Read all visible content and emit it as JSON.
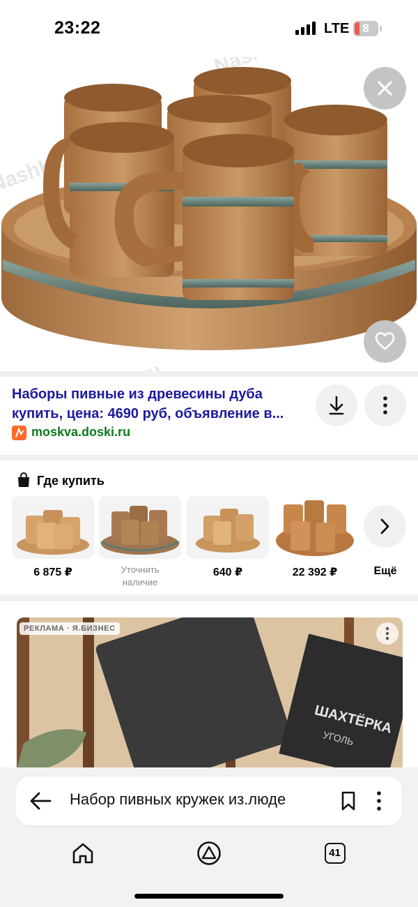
{
  "status_bar": {
    "time": "23:22",
    "network": "LTE",
    "battery": "8"
  },
  "hero": {
    "watermark": "NashKedr.ru",
    "close_icon": "close-icon",
    "favorite_icon": "heart-icon"
  },
  "result": {
    "title_line1": "Наборы пивные из древесины дуба",
    "title_line2": "купить, цена: 4690 руб, объявление в...",
    "source": "moskva.doski.ru",
    "download_icon": "download-icon",
    "more_icon": "more-vertical-icon"
  },
  "where_to_buy": {
    "title": "Где купить",
    "offers": [
      {
        "price": "6 875 ₽"
      },
      {
        "price_line1": "Уточнить",
        "price_line2": "наличие"
      },
      {
        "price": "640 ₽"
      },
      {
        "price": "22 392 ₽"
      }
    ],
    "more_label": "Ещё"
  },
  "ad": {
    "badge": "РЕКЛАМА · Я.БИЗНЕС",
    "product_text_1": "ШАХТЁРКА",
    "product_text_2": "УГОЛЬ"
  },
  "omnibox": {
    "query": "Набор пивных кружек из.люде"
  },
  "bottom_nav": {
    "tabs_count": "41"
  },
  "colors": {
    "title_link": "#1b1a9e",
    "source_link": "#0d7a1e",
    "wood": "#b98553",
    "band": "#5f7a73"
  }
}
